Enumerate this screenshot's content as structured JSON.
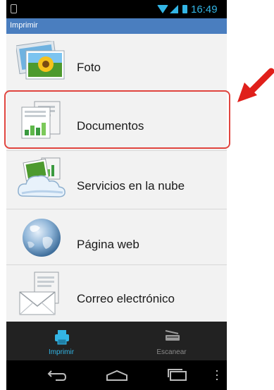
{
  "status": {
    "time": "16:49"
  },
  "header": {
    "title": "Imprimir"
  },
  "menu": {
    "items": [
      {
        "label": "Foto",
        "icon": "photo-icon"
      },
      {
        "label": "Documentos",
        "icon": "documents-icon"
      },
      {
        "label": "Servicios en la nube",
        "icon": "cloud-services-icon"
      },
      {
        "label": "Página web",
        "icon": "globe-icon"
      },
      {
        "label": "Correo electrónico",
        "icon": "email-icon"
      }
    ]
  },
  "tabs": [
    {
      "label": "Imprimir",
      "icon": "printer-icon",
      "active": true
    },
    {
      "label": "Escanear",
      "icon": "scanner-icon",
      "active": false
    }
  ],
  "colors": {
    "accent": "#33b5e5",
    "title_bar": "#4a7ebf",
    "highlight": "#e0453f"
  }
}
